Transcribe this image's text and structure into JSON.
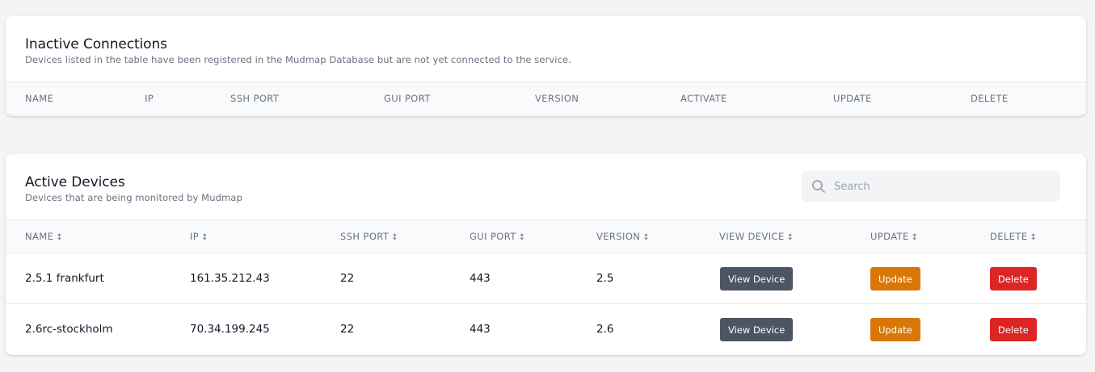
{
  "inactive": {
    "title": "Inactive Connections",
    "subtitle": "Devices listed in the table have been registered in the Mudmap Database but are not yet connected to the service.",
    "columns": [
      "NAME",
      "IP",
      "SSH PORT",
      "GUI PORT",
      "VERSION",
      "ACTIVATE",
      "UPDATE",
      "DELETE"
    ]
  },
  "active": {
    "title": "Active Devices",
    "subtitle": "Devices that are being monitored by Mudmap",
    "search": {
      "placeholder": "Search",
      "value": ""
    },
    "sort_glyph": "↕",
    "columns": [
      "NAME",
      "IP",
      "SSH PORT",
      "GUI PORT",
      "VERSION",
      "VIEW DEVICE",
      "UPDATE",
      "DELETE"
    ],
    "rows": [
      {
        "name": "2.5.1 frankfurt",
        "ip": "161.35.212.43",
        "ssh_port": "22",
        "gui_port": "443",
        "version": "2.5",
        "view_label": "View Device",
        "update_label": "Update",
        "delete_label": "Delete"
      },
      {
        "name": "2.6rc-stockholm",
        "ip": "70.34.199.245",
        "ssh_port": "22",
        "gui_port": "443",
        "version": "2.6",
        "view_label": "View Device",
        "update_label": "Update",
        "delete_label": "Delete"
      }
    ]
  },
  "colors": {
    "view_button": "#4b5563",
    "update_button": "#d97706",
    "delete_button": "#dc2626"
  }
}
